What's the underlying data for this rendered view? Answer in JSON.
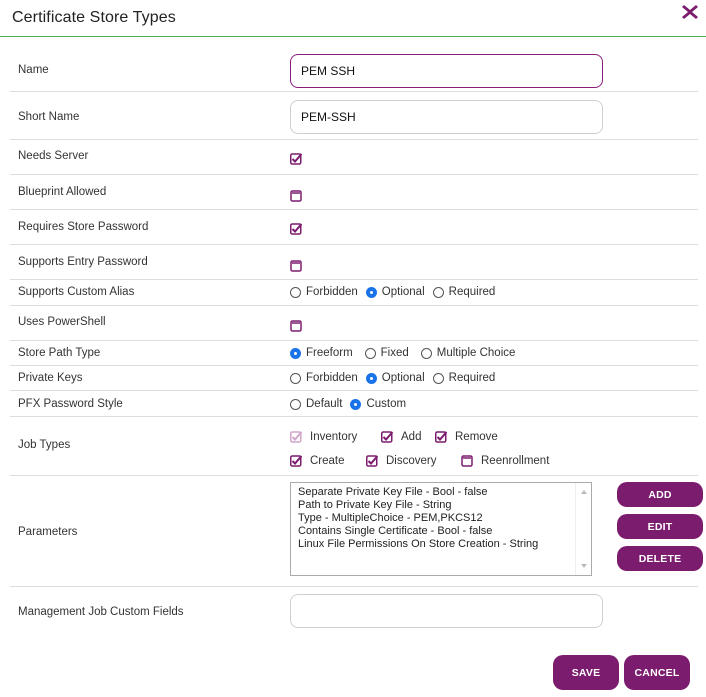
{
  "dialog": {
    "title": "Certificate Store Types",
    "close_icon": "close-x-icon"
  },
  "colors": {
    "accent": "#7b1c6e",
    "radio": "#1a73e8",
    "header_border": "#4caf50"
  },
  "fields": {
    "name": {
      "label": "Name",
      "value": "PEM SSH"
    },
    "short_name": {
      "label": "Short Name",
      "value": "PEM-SSH"
    },
    "needs_server": {
      "label": "Needs Server",
      "checked": true
    },
    "blueprint_allowed": {
      "label": "Blueprint Allowed",
      "checked": false
    },
    "requires_store_password": {
      "label": "Requires Store Password",
      "checked": true
    },
    "supports_entry_password": {
      "label": "Supports Entry Password",
      "checked": false
    },
    "supports_custom_alias": {
      "label": "Supports Custom Alias",
      "options": [
        "Forbidden",
        "Optional",
        "Required"
      ],
      "selected": "Optional"
    },
    "uses_powershell": {
      "label": "Uses PowerShell",
      "checked": false
    },
    "store_path_type": {
      "label": "Store Path Type",
      "options": [
        "Freeform",
        "Fixed",
        "Multiple Choice"
      ],
      "selected": "Freeform"
    },
    "private_keys": {
      "label": "Private Keys",
      "options": [
        "Forbidden",
        "Optional",
        "Required"
      ],
      "selected": "Optional"
    },
    "pfx_password_style": {
      "label": "PFX Password Style",
      "options": [
        "Default",
        "Custom"
      ],
      "selected": "Custom"
    },
    "job_types": {
      "label": "Job Types",
      "items": [
        {
          "label": "Inventory",
          "checked": true,
          "disabled": true
        },
        {
          "label": "Add",
          "checked": true
        },
        {
          "label": "Remove",
          "checked": true
        },
        {
          "label": "Create",
          "checked": true
        },
        {
          "label": "Discovery",
          "checked": true
        },
        {
          "label": "Reenrollment",
          "checked": false
        }
      ]
    },
    "parameters": {
      "label": "Parameters",
      "items": [
        "Separate Private Key File - Bool - false",
        "Path to Private Key File - String",
        "Type - MultipleChoice - PEM,PKCS12",
        "Contains Single Certificate - Bool - false",
        "Linux File Permissions On Store Creation - String"
      ],
      "buttons": {
        "add": "ADD",
        "edit": "EDIT",
        "delete": "DELETE"
      }
    },
    "management_job_custom_fields": {
      "label": "Management Job Custom Fields",
      "value": ""
    }
  },
  "footer": {
    "save": "SAVE",
    "cancel": "CANCEL"
  }
}
